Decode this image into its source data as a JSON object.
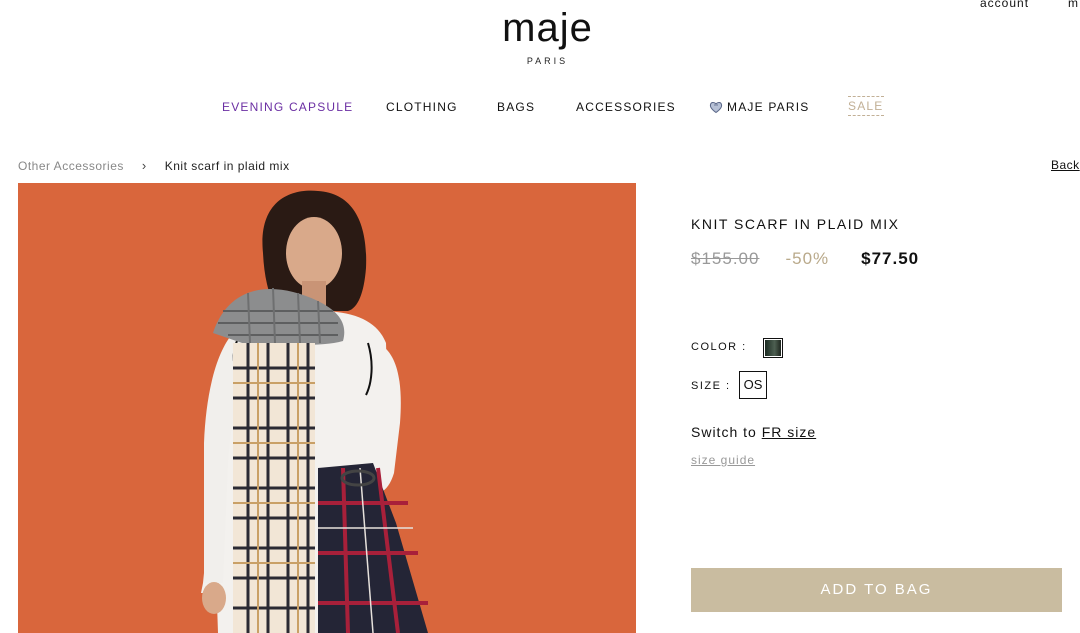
{
  "header": {
    "logo_main": "maje",
    "logo_sub": "PARIS",
    "account_label": "account",
    "truncated_label": "m"
  },
  "nav": {
    "items": [
      {
        "label": "EVENING CAPSULE"
      },
      {
        "label": "CLOTHING"
      },
      {
        "label": "BAGS"
      },
      {
        "label": "ACCESSORIES"
      },
      {
        "label": "MAJE PARIS",
        "icon": "heart-badge-icon"
      },
      {
        "label": "SALE"
      }
    ],
    "accent_color": "#6b2fa3",
    "sale_color": "#c2b096"
  },
  "breadcrumb": {
    "parent": "Other Accessories",
    "separator": "›",
    "current": "Knit scarf in plaid mix",
    "back_label": "Back"
  },
  "product": {
    "image_background_color": "#d9663c",
    "title": "KNIT SCARF IN PLAID MIX",
    "price_old": "$155.00",
    "discount": "-50%",
    "price_new": "$77.50",
    "color_label": "COLOR :",
    "size_label": "SIZE :",
    "size_value": "OS",
    "switch_prefix": "Switch to",
    "switch_link": "FR size",
    "size_guide": "size guide",
    "add_to_bag": "ADD TO BAG",
    "button_color": "#c9bca0"
  }
}
